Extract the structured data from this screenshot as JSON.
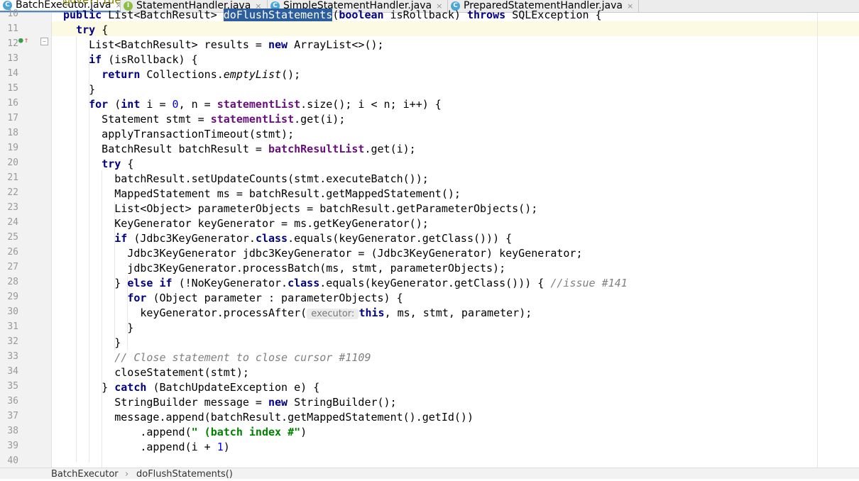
{
  "tabs": [
    {
      "icon": "class-icon",
      "glyph": "C",
      "label": "BatchExecutor.java",
      "active": true
    },
    {
      "icon": "interface-icon",
      "glyph": "I",
      "label": "StatementHandler.java",
      "active": false
    },
    {
      "icon": "class-icon",
      "glyph": "C",
      "label": "SimpleStatementHandler.java",
      "active": false
    },
    {
      "icon": "class-icon",
      "glyph": "C",
      "label": "PreparedStatementHandler.java",
      "active": false
    }
  ],
  "tab_close_glyph": "×",
  "line_numbers": [
    "10",
    "11",
    "12",
    "13",
    "14",
    "15",
    "16",
    "17",
    "18",
    "19",
    "20",
    "21",
    "22",
    "23",
    "24",
    "25",
    "26",
    "27",
    "28",
    "29",
    "30",
    "31",
    "32",
    "33",
    "34",
    "35",
    "36",
    "37",
    "38",
    "39",
    "40"
  ],
  "code_lines": [
    [
      {
        "t": "@Override",
        "c": "ann"
      }
    ],
    [
      {
        "t": "public ",
        "c": "kw"
      },
      {
        "t": "List<BatchResult> "
      },
      {
        "t": "doFlushStatements",
        "c": "sel"
      },
      {
        "t": "("
      },
      {
        "t": "boolean ",
        "c": "kw"
      },
      {
        "t": "isRollback) "
      },
      {
        "t": "throws ",
        "c": "kw"
      },
      {
        "t": "SQLException {"
      }
    ],
    [
      {
        "t": "  "
      },
      {
        "t": "try ",
        "c": "kw"
      },
      {
        "t": "{"
      }
    ],
    [
      {
        "t": "    List<BatchResult> results = "
      },
      {
        "t": "new ",
        "c": "kw"
      },
      {
        "t": "ArrayList<>();"
      }
    ],
    [
      {
        "t": "    "
      },
      {
        "t": "if ",
        "c": "kw"
      },
      {
        "t": "(isRollback) {"
      }
    ],
    [
      {
        "t": "      "
      },
      {
        "t": "return ",
        "c": "kw"
      },
      {
        "t": "Collections."
      },
      {
        "t": "emptyList",
        "c": "ital"
      },
      {
        "t": "();"
      }
    ],
    [
      {
        "t": "    }"
      }
    ],
    [
      {
        "t": "    "
      },
      {
        "t": "for ",
        "c": "kw"
      },
      {
        "t": "("
      },
      {
        "t": "int ",
        "c": "kw"
      },
      {
        "t": "i = "
      },
      {
        "t": "0",
        "c": "num"
      },
      {
        "t": ", n = "
      },
      {
        "t": "statementList",
        "c": "fld"
      },
      {
        "t": ".size(); i < n; i++) {"
      }
    ],
    [
      {
        "t": "      Statement stmt = "
      },
      {
        "t": "statementList",
        "c": "fld"
      },
      {
        "t": ".get(i);"
      }
    ],
    [
      {
        "t": "      applyTransactionTimeout(stmt);"
      }
    ],
    [
      {
        "t": "      BatchResult batchResult = "
      },
      {
        "t": "batchResultList",
        "c": "fld"
      },
      {
        "t": ".get(i);"
      }
    ],
    [
      {
        "t": "      "
      },
      {
        "t": "try ",
        "c": "kw"
      },
      {
        "t": "{"
      }
    ],
    [
      {
        "t": "        batchResult.setUpdateCounts(stmt.executeBatch());"
      }
    ],
    [
      {
        "t": "        MappedStatement ms = batchResult.getMappedStatement();"
      }
    ],
    [
      {
        "t": "        List<Object> parameterObjects = batchResult.getParameterObjects();"
      }
    ],
    [
      {
        "t": "        KeyGenerator keyGenerator = ms.getKeyGenerator();"
      }
    ],
    [
      {
        "t": "        "
      },
      {
        "t": "if ",
        "c": "kw"
      },
      {
        "t": "(Jdbc3KeyGenerator."
      },
      {
        "t": "class",
        "c": "kw"
      },
      {
        "t": ".equals(keyGenerator.getClass())) {"
      }
    ],
    [
      {
        "t": "          Jdbc3KeyGenerator jdbc3KeyGenerator = (Jdbc3KeyGenerator) keyGenerator;"
      }
    ],
    [
      {
        "t": "          jdbc3KeyGenerator.processBatch(ms, stmt, parameterObjects);"
      }
    ],
    [
      {
        "t": "        } "
      },
      {
        "t": "else if ",
        "c": "kw"
      },
      {
        "t": "(!NoKeyGenerator."
      },
      {
        "t": "class",
        "c": "kw"
      },
      {
        "t": ".equals(keyGenerator.getClass())) { "
      },
      {
        "t": "//issue #141",
        "c": "cmt"
      }
    ],
    [
      {
        "t": "          "
      },
      {
        "t": "for ",
        "c": "kw"
      },
      {
        "t": "(Object parameter : parameterObjects) {"
      }
    ],
    [
      {
        "t": "            keyGenerator.processAfter("
      },
      {
        "t": " executor: ",
        "c": "hint"
      },
      {
        "t": "this",
        "c": "kw"
      },
      {
        "t": ", ms, stmt, parameter);"
      }
    ],
    [
      {
        "t": "          }"
      }
    ],
    [
      {
        "t": "        }"
      }
    ],
    [
      {
        "t": "        "
      },
      {
        "t": "// Close statement to close cursor #1109",
        "c": "cmt"
      }
    ],
    [
      {
        "t": "        closeStatement(stmt);"
      }
    ],
    [
      {
        "t": "      } "
      },
      {
        "t": "catch ",
        "c": "kw"
      },
      {
        "t": "(BatchUpdateException e) {"
      }
    ],
    [
      {
        "t": "        StringBuilder message = "
      },
      {
        "t": "new ",
        "c": "kw"
      },
      {
        "t": "StringBuilder();"
      }
    ],
    [
      {
        "t": "        message.append(batchResult.getMappedStatement().getId())"
      }
    ],
    [
      {
        "t": "            .append("
      },
      {
        "t": "\" (batch index #\"",
        "c": "str"
      },
      {
        "t": ")"
      }
    ],
    [
      {
        "t": "            .append(i + "
      },
      {
        "t": "1",
        "c": "num"
      },
      {
        "t": ")"
      }
    ]
  ],
  "gutter_icons": {
    "override": "overriding-method-icon",
    "up": "go-to-super-icon",
    "fold": "fold-icon"
  },
  "breadcrumb": {
    "class": "BatchExecutor",
    "separator": "›",
    "method": "doFlushStatements()"
  }
}
